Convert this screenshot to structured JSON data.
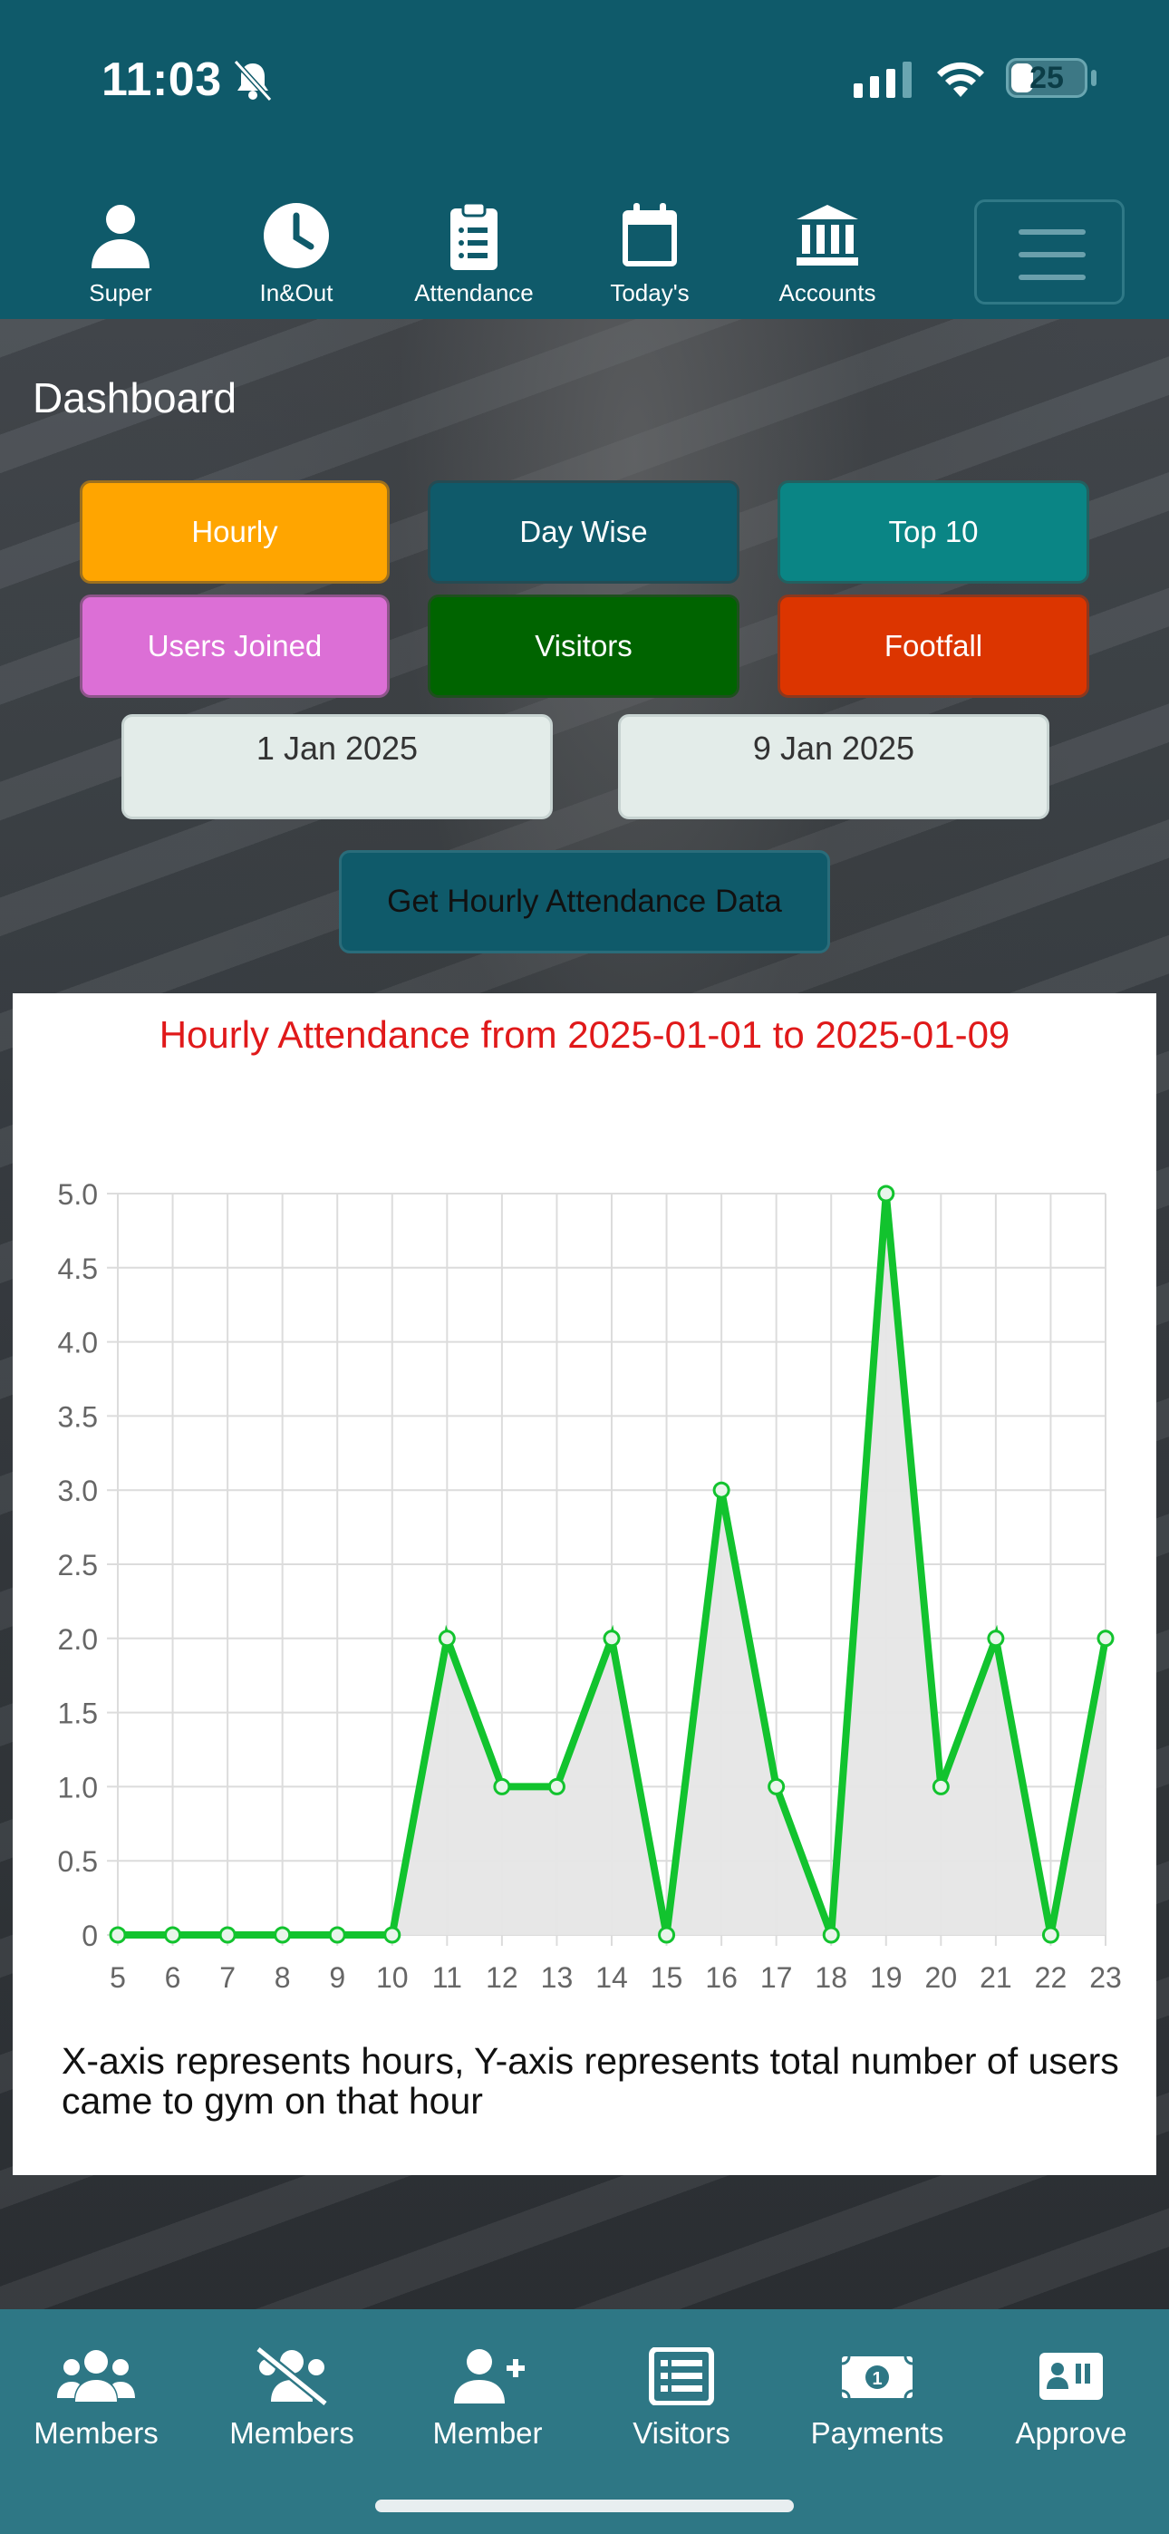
{
  "status_bar": {
    "time": "11:03",
    "battery": "25"
  },
  "top_nav": [
    {
      "label": "Super",
      "icon": "user-icon"
    },
    {
      "label": "In&Out",
      "icon": "clock-icon"
    },
    {
      "label": "Attendance",
      "icon": "clipboard-icon"
    },
    {
      "label": "Today's",
      "icon": "calendar-icon"
    },
    {
      "label": "Accounts",
      "icon": "bank-icon"
    }
  ],
  "page_title": "Dashboard",
  "report_buttons": [
    {
      "label": "Hourly",
      "color": "#ffa500"
    },
    {
      "label": "Day Wise",
      "color": "#0f5a6a"
    },
    {
      "label": "Top 10",
      "color": "#0a8585"
    },
    {
      "label": "Users Joined",
      "color": "#dc6fd6"
    },
    {
      "label": "Visitors",
      "color": "#006400"
    },
    {
      "label": "Footfall",
      "color": "#dc3500"
    }
  ],
  "date_range": {
    "from": "1 Jan 2025",
    "to": "9 Jan 2025"
  },
  "fetch_button": "Get Hourly Attendance Data",
  "chart_data": {
    "type": "line",
    "title": "Hourly Attendance from 2025-01-01 to 2025-01-09",
    "x": [
      5,
      6,
      7,
      8,
      9,
      10,
      11,
      12,
      13,
      14,
      15,
      16,
      17,
      18,
      19,
      20,
      21,
      22,
      23
    ],
    "series": [
      {
        "values": [
          0,
          0,
          0,
          0,
          0,
          0,
          2,
          1,
          1,
          2,
          0,
          3,
          1,
          0,
          5,
          1,
          2,
          0,
          2
        ],
        "color": "#12c32e"
      }
    ],
    "ylim": [
      0,
      5
    ],
    "yticks": [
      "0",
      "0.5",
      "1.0",
      "1.5",
      "2.0",
      "2.5",
      "3.0",
      "3.5",
      "4.0",
      "4.5",
      "5.0"
    ],
    "xlabel": "",
    "ylabel": "",
    "grid": true,
    "fill": "#e6e6e6"
  },
  "chart_caption": "X-axis represents hours, Y-axis represents total number of users came to gym on that hour",
  "bottom_tabs": [
    {
      "label": "Members",
      "icon": "users-icon"
    },
    {
      "label": "Members",
      "icon": "users-slash-icon"
    },
    {
      "label": "Member",
      "icon": "user-plus-icon"
    },
    {
      "label": "Visitors",
      "icon": "list-icon"
    },
    {
      "label": "Payments",
      "icon": "money-icon"
    },
    {
      "label": "Approve",
      "icon": "id-card-icon"
    }
  ]
}
